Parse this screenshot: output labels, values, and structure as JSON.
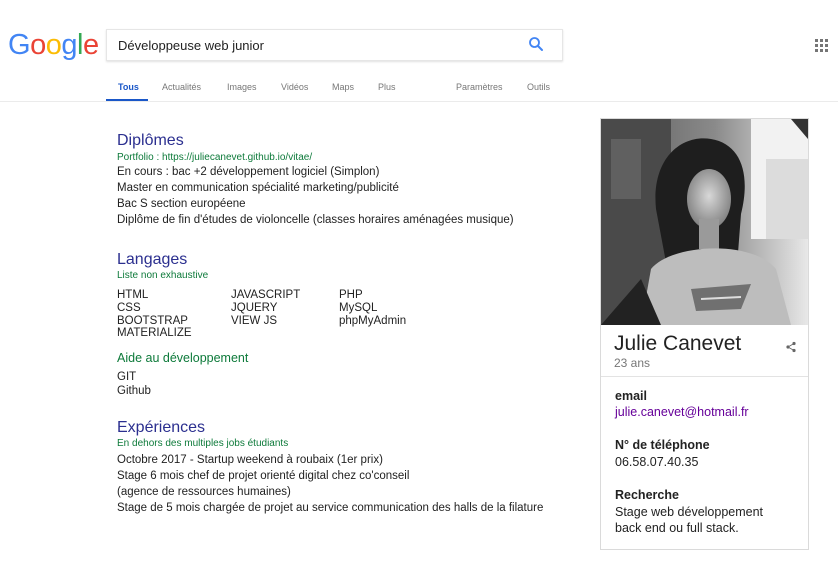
{
  "logo": {
    "letters": [
      "G",
      "o",
      "o",
      "g",
      "l",
      "e"
    ],
    "colors": [
      "#4285f4",
      "#ea4335",
      "#fbbc05",
      "#4285f4",
      "#34a853",
      "#ea4335"
    ]
  },
  "search": {
    "query": "Développeuse web junior",
    "icon": "search-icon"
  },
  "apps_icon": "apps-grid-icon",
  "nav": {
    "tabs": [
      "Tous",
      "Actualités",
      "Images",
      "Vidéos",
      "Maps",
      "Plus"
    ],
    "active": "Tous",
    "settings": "Paramètres",
    "tools": "Outils",
    "accent": "#1a57c8"
  },
  "diplomes": {
    "title": "Diplômes",
    "subtitle": "Portfolio : https://juliecanevet.github.io/vitae/",
    "lines": [
      "En cours : bac +2 développement logiciel (Simplon)",
      "Master en communication spécialité marketing/publicité",
      "Bac S section européene",
      "Diplôme de fin d'études de violoncelle (classes horaires aménagées musique)"
    ]
  },
  "langages": {
    "title": "Langages",
    "subtitle": "Liste non exhaustive",
    "col1": [
      "HTML",
      "CSS",
      "BOOTSTRAP",
      "MATERIALIZE"
    ],
    "col2": [
      "JAVASCRIPT",
      "JQUERY",
      "VIEW JS"
    ],
    "col3": [
      "PHP",
      "MySQL",
      "phpMyAdmin"
    ],
    "aide_title": "Aide au développement",
    "aide": [
      "GIT",
      "Github"
    ]
  },
  "experiences": {
    "title": "Expériences",
    "subtitle": "En dehors des multiples jobs étudiants",
    "lines": [
      "Octobre 2017 - Startup weekend à roubaix (1er prix)",
      "Stage 6 mois chef de projet orienté digital chez co'conseil",
      "(agence de ressources humaines)",
      "Stage de 5 mois chargée de projet au service communication des halls de la filature"
    ]
  },
  "panel": {
    "name": "Julie Canevet",
    "age": "23 ans",
    "share_icon": "share-icon",
    "email_label": "email",
    "email": "julie.canevet@hotmail.fr",
    "phone_label": "N° de téléphone",
    "phone": "06.58.07.40.35",
    "search_label": "Recherche",
    "search_lines": [
      "Stage web développement",
      "back end ou full stack."
    ]
  }
}
